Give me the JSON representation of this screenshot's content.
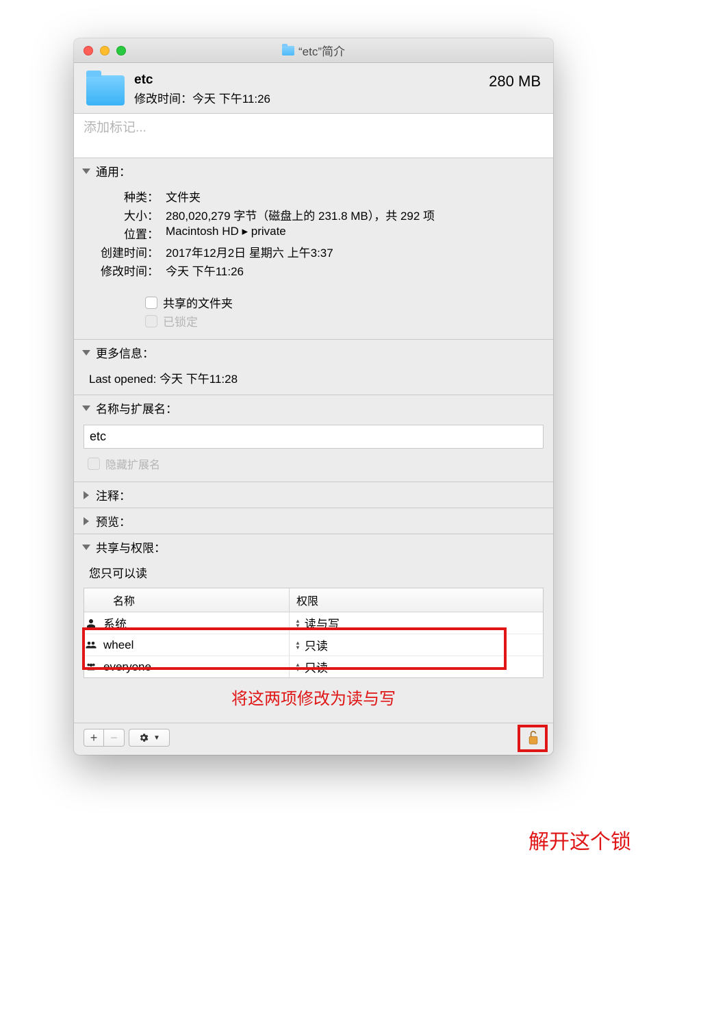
{
  "titlebar": {
    "title": "“etc”简介"
  },
  "header": {
    "name": "etc",
    "modified_label": "修改时间：",
    "modified_value": "今天 下午11:26",
    "size": "280 MB"
  },
  "tags": {
    "placeholder": "添加标记..."
  },
  "general": {
    "title": "通用：",
    "kind_label": "种类：",
    "kind_value": "文件夹",
    "size_label": "大小：",
    "size_value": "280,020,279 字节（磁盘上的 231.8 MB），共 292 项",
    "where_label": "位置：",
    "where_value": "Macintosh HD ▸ private",
    "created_label": "创建时间：",
    "created_value": "2017年12月2日 星期六 上午3:37",
    "modified_label": "修改时间：",
    "modified_value": "今天 下午11:26",
    "shared_label": "共享的文件夹",
    "locked_label": "已锁定"
  },
  "more": {
    "title": "更多信息：",
    "last_opened_label": "Last opened:",
    "last_opened_value": "今天 下午11:28"
  },
  "name_ext": {
    "title": "名称与扩展名：",
    "value": "etc",
    "hide_label": "隐藏扩展名"
  },
  "comments": {
    "title": "注释："
  },
  "preview": {
    "title": "预览："
  },
  "sharing": {
    "title": "共享与权限：",
    "readonly_notice": "您只可以读",
    "col_name": "名称",
    "col_perm": "权限",
    "rows": [
      {
        "name": "系统",
        "perm": "读与写"
      },
      {
        "name": "wheel",
        "perm": "只读"
      },
      {
        "name": "everyone",
        "perm": "只读"
      }
    ]
  },
  "annotations": {
    "perm_hint": "将这两项修改为读与写",
    "lock_hint": "解开这个锁"
  }
}
